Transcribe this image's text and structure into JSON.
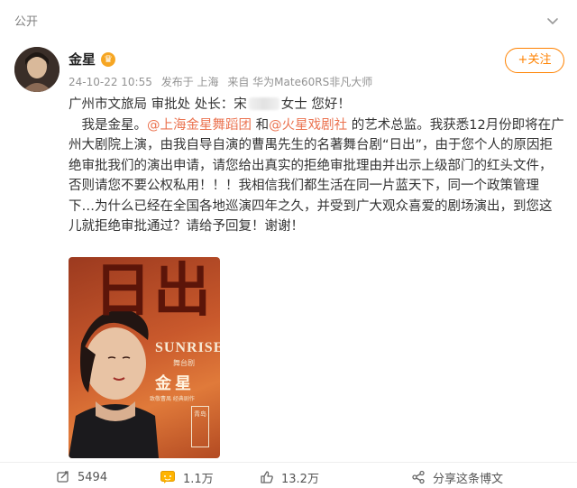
{
  "topbar": {
    "visibility_label": "公开"
  },
  "author": {
    "name": "金星",
    "badge_icon": "vip-crown-icon",
    "follow_label": "+关注"
  },
  "meta": {
    "time": "24-10-22 10:55",
    "location": "发布于 上海",
    "source": "来自 华为Mate60RS非凡大师"
  },
  "post": {
    "line1_prefix": "广州市文旅局 审批处 处长：宋",
    "line1_suffix": "女士 您好！",
    "para2_start": "我是金星。",
    "mention1": "@上海金星舞蹈团",
    "and_word": " 和",
    "mention2": "@火星戏剧社",
    "para2_rest": " 的艺术总监。我获悉12月份即将在广州大剧院上演，由我自导自演的曹禺先生的名著舞台剧“日出”，由于您个人的原因拒绝审批我们的演出申请，请您给出真实的拒绝审批理由并出示上级部门的红头文件，否则请您不要公权私用！！！我相信我们都生活在同一片蓝天下，同一个政策管理下…为什么已经在全国各地巡演四年之久，并受到广大观众喜爱的剧场演出，到您这儿就拒绝审批通过？请给予回复！谢谢！"
  },
  "poster": {
    "title": "日出",
    "english": "SUNRISE",
    "subtitle": "舞台剧",
    "name": "金星",
    "tagline": "致敬曹禺 经典剧作",
    "seal": "青岛"
  },
  "actions": {
    "repost_count": "5494",
    "comment_count": "1.1万",
    "like_count": "13.2万",
    "share_label": "分享这条博文"
  },
  "colors": {
    "accent": "#ff8200",
    "mention": "#eb7350",
    "meta": "#939393"
  }
}
